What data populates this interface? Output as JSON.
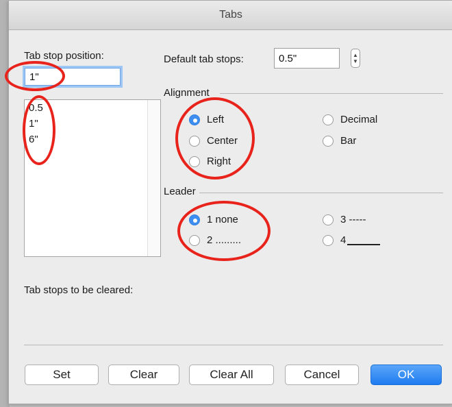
{
  "dialog": {
    "title": "Tabs"
  },
  "tab_stop": {
    "label": "Tab stop position:",
    "value": "1\"",
    "list": [
      "0.5",
      "1\"",
      "6\""
    ]
  },
  "default_tabs": {
    "label": "Default tab stops:",
    "value": "0.5\""
  },
  "alignment": {
    "label": "Alignment",
    "options": [
      {
        "label": "Left",
        "selected": true
      },
      {
        "label": "Center",
        "selected": false
      },
      {
        "label": "Right",
        "selected": false
      },
      {
        "label": "Decimal",
        "selected": false
      },
      {
        "label": "Bar",
        "selected": false
      }
    ]
  },
  "leader": {
    "label": "Leader",
    "options": [
      {
        "label": "1 none",
        "selected": true
      },
      {
        "label": "2 .........",
        "selected": false
      },
      {
        "label": "3 -----",
        "selected": false
      },
      {
        "label": "4",
        "selected": false
      }
    ]
  },
  "cleared": {
    "label": "Tab stops to be cleared:"
  },
  "buttons": {
    "set": "Set",
    "clear": "Clear",
    "clear_all": "Clear All",
    "cancel": "Cancel",
    "ok": "OK"
  },
  "colors": {
    "accent": "#1f7cf0",
    "annotation": "#e8231b"
  }
}
